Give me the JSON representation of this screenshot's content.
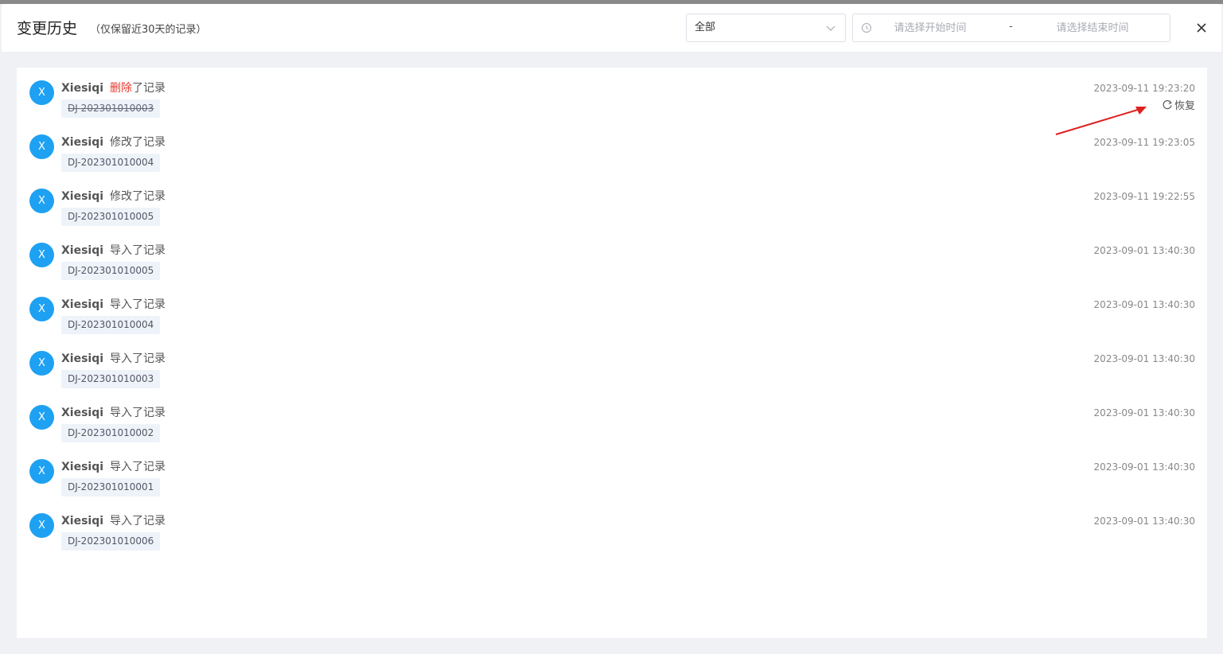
{
  "dialog": {
    "title": "变更历史",
    "subtitle": "（仅保留近30天的记录）"
  },
  "filter": {
    "type_value": "全部",
    "start_placeholder": "请选择开始时间",
    "end_placeholder": "请选择结束时间",
    "separator": "-"
  },
  "colors": {
    "avatar": "#1ea1f2",
    "deleted_action": "#e4392f",
    "annotation_arrow": "#e02020"
  },
  "icons": {
    "select": "chevron-down-icon",
    "date": "clock-icon",
    "close": "close-icon",
    "restore": "refresh-icon"
  },
  "records": [
    {
      "avatar": "X",
      "user": "Xiesiqi",
      "action": "删除",
      "suffix": "了记录",
      "tag": "DJ-202301010003",
      "time": "2023-09-11 19:23:20",
      "deleted": true,
      "restore_label": "恢复"
    },
    {
      "avatar": "X",
      "user": "Xiesiqi",
      "action": "修改",
      "suffix": "了记录",
      "tag": "DJ-202301010004",
      "time": "2023-09-11 19:23:05"
    },
    {
      "avatar": "X",
      "user": "Xiesiqi",
      "action": "修改",
      "suffix": "了记录",
      "tag": "DJ-202301010005",
      "time": "2023-09-11 19:22:55"
    },
    {
      "avatar": "X",
      "user": "Xiesiqi",
      "action": "导入",
      "suffix": "了记录",
      "tag": "DJ-202301010005",
      "time": "2023-09-01 13:40:30"
    },
    {
      "avatar": "X",
      "user": "Xiesiqi",
      "action": "导入",
      "suffix": "了记录",
      "tag": "DJ-202301010004",
      "time": "2023-09-01 13:40:30"
    },
    {
      "avatar": "X",
      "user": "Xiesiqi",
      "action": "导入",
      "suffix": "了记录",
      "tag": "DJ-202301010003",
      "time": "2023-09-01 13:40:30"
    },
    {
      "avatar": "X",
      "user": "Xiesiqi",
      "action": "导入",
      "suffix": "了记录",
      "tag": "DJ-202301010002",
      "time": "2023-09-01 13:40:30"
    },
    {
      "avatar": "X",
      "user": "Xiesiqi",
      "action": "导入",
      "suffix": "了记录",
      "tag": "DJ-202301010001",
      "time": "2023-09-01 13:40:30"
    },
    {
      "avatar": "X",
      "user": "Xiesiqi",
      "action": "导入",
      "suffix": "了记录",
      "tag": "DJ-202301010006",
      "time": "2023-09-01 13:40:30"
    }
  ]
}
